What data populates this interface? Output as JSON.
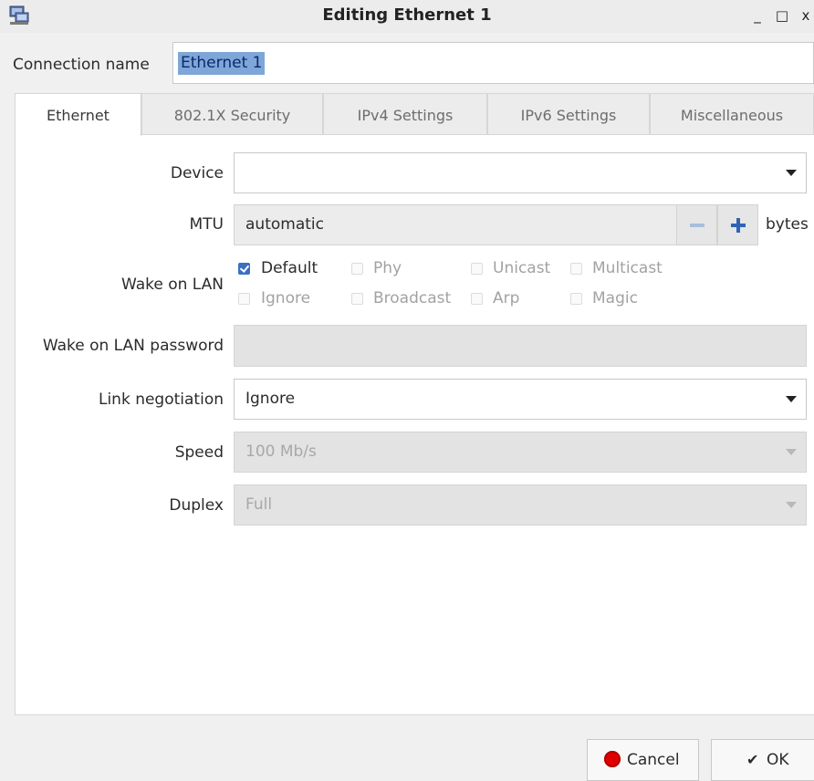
{
  "window": {
    "title": "Editing Ethernet 1",
    "icon": "network-computer-icon",
    "controls": {
      "minimize": "_",
      "maximize": "□",
      "close": "x"
    }
  },
  "connection": {
    "label": "Connection name",
    "value": "Ethernet 1"
  },
  "tabs": [
    {
      "label": "Ethernet",
      "active": true
    },
    {
      "label": "802.1X Security",
      "active": false
    },
    {
      "label": "IPv4 Settings",
      "active": false
    },
    {
      "label": "IPv6 Settings",
      "active": false
    },
    {
      "label": "Miscellaneous",
      "active": false
    }
  ],
  "ethernet": {
    "device": {
      "label": "Device",
      "value": ""
    },
    "mtu": {
      "label": "MTU",
      "value": "automatic",
      "unit": "bytes"
    },
    "wol": {
      "label": "Wake on LAN",
      "options": [
        {
          "label": "Default",
          "checked": true,
          "enabled": true
        },
        {
          "label": "Phy",
          "checked": false,
          "enabled": false
        },
        {
          "label": "Unicast",
          "checked": false,
          "enabled": false
        },
        {
          "label": "Multicast",
          "checked": false,
          "enabled": false
        },
        {
          "label": "Ignore",
          "checked": false,
          "enabled": false
        },
        {
          "label": "Broadcast",
          "checked": false,
          "enabled": false
        },
        {
          "label": "Arp",
          "checked": false,
          "enabled": false
        },
        {
          "label": "Magic",
          "checked": false,
          "enabled": false
        }
      ]
    },
    "wol_password": {
      "label": "Wake on LAN password",
      "value": ""
    },
    "link_negotiation": {
      "label": "Link negotiation",
      "value": "Ignore"
    },
    "speed": {
      "label": "Speed",
      "value": "100 Mb/s",
      "enabled": false
    },
    "duplex": {
      "label": "Duplex",
      "value": "Full",
      "enabled": false
    }
  },
  "buttons": {
    "cancel": "Cancel",
    "ok": "OK",
    "ok_icon": "✔"
  },
  "colors": {
    "selection": "#7fa6d8",
    "checkbox_checked": "#3a70c2",
    "cancel_icon": "#e00000"
  }
}
